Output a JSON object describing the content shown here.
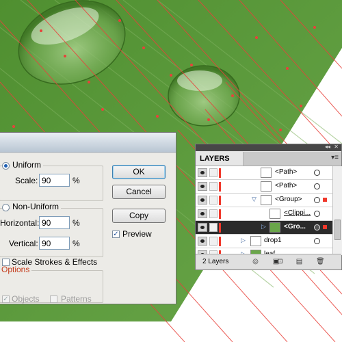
{
  "dialog": {
    "uniform_label": "Uniform",
    "scale_label": "Scale:",
    "scale_value": "90",
    "percent": "%",
    "nonuniform_label": "Non-Uniform",
    "horizontal_label": "Horizontal:",
    "horizontal_value": "90",
    "vertical_label": "Vertical:",
    "vertical_value": "90",
    "options_label": "Options",
    "scale_strokes_label": "Scale Strokes & Effects",
    "objects_label": "Objects",
    "patterns_label": "Patterns",
    "ok_label": "OK",
    "cancel_label": "Cancel",
    "copy_label": "Copy",
    "preview_label": "Preview",
    "uniform_selected": true,
    "preview_checked": true,
    "objects_checked": true
  },
  "layers": {
    "tab_label": "LAYERS",
    "rows": [
      {
        "name": "<Path>",
        "selected": false
      },
      {
        "name": "<Path>",
        "selected": false
      },
      {
        "name": "<Group>",
        "selected": false
      },
      {
        "name": "<Clippi...",
        "selected": false
      },
      {
        "name": "<Gro...",
        "selected": true
      },
      {
        "name": "drop1",
        "selected": false
      },
      {
        "name": "leaf",
        "selected": false
      }
    ],
    "footer_count": "2 Layers",
    "accent_color": "#f0382b"
  },
  "colors": {
    "leaf_green": "#5c9a3c",
    "guide_red": "#e8413a"
  }
}
